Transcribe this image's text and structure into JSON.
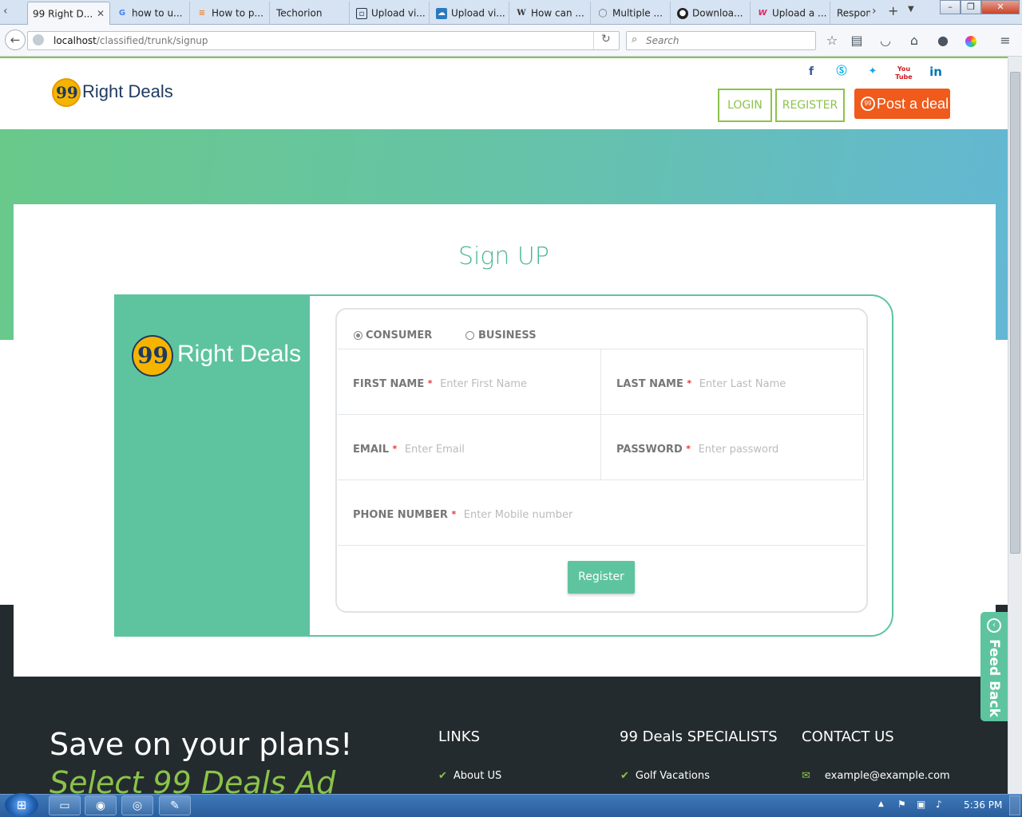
{
  "browser": {
    "tabs": [
      {
        "label": "99 Right D...",
        "icon": "page-icon",
        "active": true
      },
      {
        "label": "how to u...",
        "icon": "google-icon"
      },
      {
        "label": "How to p...",
        "icon": "stack-icon"
      },
      {
        "label": "Techorion",
        "icon": ""
      },
      {
        "label": "Upload vi...",
        "icon": "upload-icon"
      },
      {
        "label": "Upload vi...",
        "icon": "cloud-icon"
      },
      {
        "label": "How can ...",
        "icon": "wiki-icon"
      },
      {
        "label": "Multiple ...",
        "icon": "egg-icon"
      },
      {
        "label": "Downloa...",
        "icon": "github-icon"
      },
      {
        "label": "Upload a ...",
        "icon": "w-icon"
      },
      {
        "label": "Respon",
        "icon": ""
      }
    ],
    "url_host": "localhost",
    "url_path": "/classified/trunk/signup",
    "search_placeholder": "Search"
  },
  "header": {
    "logo_mark": "99",
    "logo_text": "Right Deals",
    "social": [
      {
        "icon": "facebook-icon",
        "glyph": "f",
        "color": "#3b5998"
      },
      {
        "icon": "skype-icon",
        "glyph": "S",
        "color": "#00aff0"
      },
      {
        "icon": "twitter-icon",
        "glyph": "t",
        "color": "#1da1f2"
      },
      {
        "icon": "youtube-icon",
        "glyph": "You",
        "color": "#cc181e"
      },
      {
        "icon": "linkedin-icon",
        "glyph": "in",
        "color": "#0077b5"
      }
    ],
    "login_label": "LOGIN",
    "register_label": "REGISTER",
    "post_deal_label": "Post a deal"
  },
  "signup": {
    "title": "Sign UP",
    "panel_logo_mark": "99",
    "panel_logo_text": "Right Deals",
    "account_types": [
      {
        "label": "CONSUMER",
        "selected": true
      },
      {
        "label": "BUSINESS",
        "selected": false
      }
    ],
    "fields": {
      "first_name": {
        "label": "FIRST NAME",
        "placeholder": "Enter First Name"
      },
      "last_name": {
        "label": "LAST NAME",
        "placeholder": "Enter Last Name"
      },
      "email": {
        "label": "EMAIL",
        "placeholder": "Enter Email"
      },
      "password": {
        "label": "PASSWORD",
        "placeholder": "Enter password"
      },
      "phone": {
        "label": "PHONE NUMBER",
        "placeholder": "Enter Mobile number"
      }
    },
    "required_mark": "*",
    "register_button": "Register"
  },
  "feedback_label": "Feed Back",
  "footer": {
    "headline": "Save on your plans!",
    "subheadline": "Select 99 Deals Ad",
    "links_title": "LINKS",
    "links": [
      "About US"
    ],
    "specialists_title": "99 Deals SPECIALISTS",
    "specialists": [
      "Golf Vacations"
    ],
    "contact_title": "CONTACT US",
    "contact_email": "example@example.com"
  },
  "taskbar": {
    "time": "5:36 PM"
  },
  "colors": {
    "brand_green": "#5ec4a0",
    "accent_lime": "#8bc34a",
    "post_orange": "#f05a1a",
    "footer_dark": "#242b2e"
  }
}
